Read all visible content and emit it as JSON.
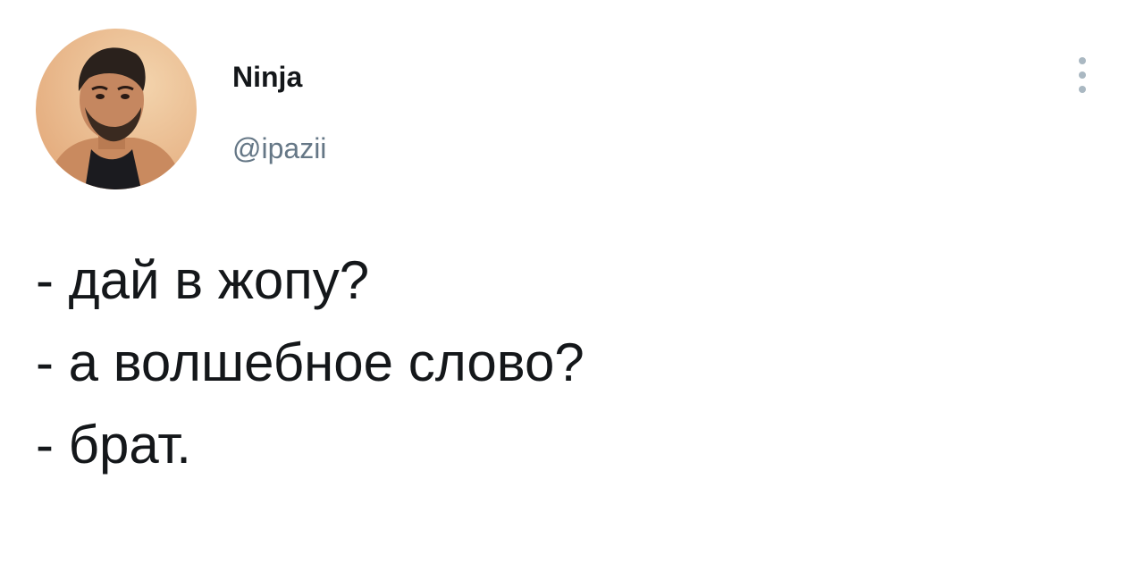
{
  "author": {
    "display_name": "Ninja",
    "handle": "@ipazii",
    "avatar_icon": "user-avatar-photo"
  },
  "menu": {
    "icon": "vertical-ellipsis-icon"
  },
  "tweet": {
    "lines": [
      "- дай в жопу?",
      "- а волшебное слово?",
      "- брат."
    ]
  },
  "colors": {
    "text": "#14171a",
    "secondary_text": "#657786",
    "menu_dots": "#aab8c2",
    "background": "#ffffff"
  }
}
